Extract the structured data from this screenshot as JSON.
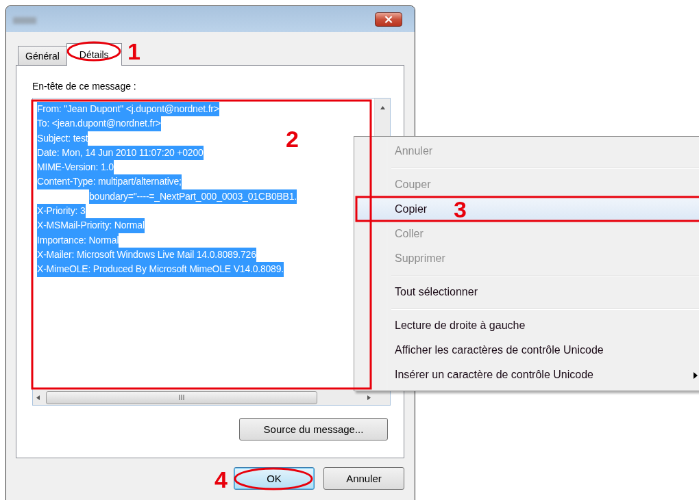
{
  "window": {
    "close": "×"
  },
  "tabs": [
    {
      "label": "Général",
      "selected": false
    },
    {
      "label": "Détails",
      "selected": true
    }
  ],
  "header_label": "En-tête de ce message :",
  "header_lines": [
    {
      "text": "From: \"Jean Dupont\" <j.dupont@nordnet.fr>",
      "kind": "field",
      "selected": true
    },
    {
      "text": "To: <jean.dupont@nordnet.fr>",
      "kind": "field",
      "selected": true
    },
    {
      "text": "Subject: test",
      "kind": "field",
      "selected": true
    },
    {
      "text": "Date: Mon, 14 Jun 2010 11:07:20 +0200",
      "kind": "field",
      "selected": true
    },
    {
      "text": "MIME-Version: 1.0",
      "kind": "field",
      "selected": true
    },
    {
      "text": "Content-Type: multipart/alternative;",
      "kind": "field",
      "selected": true
    },
    {
      "text": "boundary=\"----=_NextPart_000_0003_01CB0BB1.",
      "kind": "continuation",
      "selected": true
    },
    {
      "text": "X-Priority: 3",
      "kind": "field",
      "selected": true
    },
    {
      "text": "X-MSMail-Priority: Normal",
      "kind": "field",
      "selected": true
    },
    {
      "text": "Importance: Normal",
      "kind": "field",
      "selected": true
    },
    {
      "text": "X-Mailer: Microsoft Windows Live Mail 14.0.8089.726",
      "kind": "field",
      "selected": true
    },
    {
      "text": "X-MimeOLE: Produced By Microsoft MimeOLE V14.0.8089.",
      "kind": "field",
      "selected": true
    }
  ],
  "source_button": "Source du message...",
  "buttons": [
    {
      "label": "OK",
      "default": true
    },
    {
      "label": "Annuler",
      "default": false
    }
  ],
  "context_menu": {
    "groups": [
      [
        {
          "label": "Annuler",
          "disabled": true,
          "selected": false,
          "submenu": false
        }
      ],
      [
        {
          "label": "Couper",
          "disabled": true,
          "selected": false,
          "submenu": false
        },
        {
          "label": "Copier",
          "disabled": false,
          "selected": true,
          "submenu": false
        },
        {
          "label": "Coller",
          "disabled": true,
          "selected": false,
          "submenu": false
        },
        {
          "label": "Supprimer",
          "disabled": true,
          "selected": false,
          "submenu": false
        }
      ],
      [
        {
          "label": "Tout sélectionner",
          "disabled": false,
          "selected": false,
          "submenu": false
        }
      ],
      [
        {
          "label": "Lecture de droite à gauche",
          "disabled": false,
          "selected": false,
          "submenu": false
        },
        {
          "label": "Afficher les caractères de contrôle Unicode",
          "disabled": false,
          "selected": false,
          "submenu": false
        },
        {
          "label": "Insérer un caractère de contrôle Unicode",
          "disabled": false,
          "selected": false,
          "submenu": true
        }
      ]
    ]
  },
  "annotations": [
    {
      "label": "1",
      "kind": "ellipse"
    },
    {
      "label": "2",
      "kind": "rect"
    },
    {
      "label": "3",
      "kind": "rect"
    },
    {
      "label": "4",
      "kind": "ellipse"
    }
  ]
}
